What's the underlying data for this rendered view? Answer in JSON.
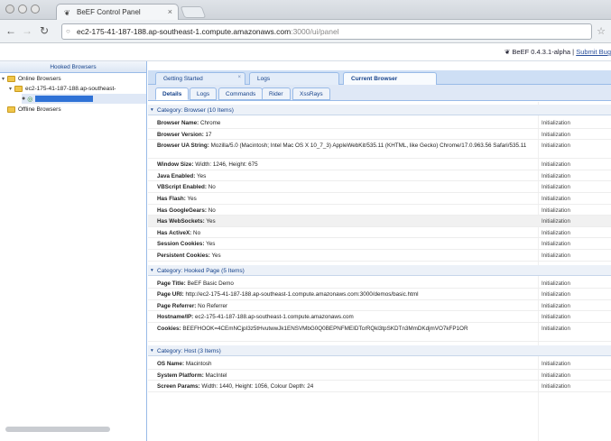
{
  "browser": {
    "tab_title": "BeEF Control Panel",
    "tab_favicon": "beef-logo-icon",
    "url_host": "ec2-175-41-187-188.ap-southeast-1.compute.amazonaws.com",
    "url_rest": ":3000/ui/panel"
  },
  "header": {
    "app_name": "BeEF",
    "version": "0.4.3.1-alpha",
    "submit_bug": "Submit Bug"
  },
  "sidebar": {
    "title": "Hooked Browsers",
    "online_label": "Online Browsers",
    "host_label": "ec2-175-41-187-188.ap-southeast-",
    "offline_label": "Offline Browsers"
  },
  "top_tabs": [
    {
      "label": "Getting Started"
    },
    {
      "label": "Logs"
    },
    {
      "label": "Current Browser"
    }
  ],
  "sub_tabs": [
    {
      "label": "Details"
    },
    {
      "label": "Logs"
    },
    {
      "label": "Commands"
    },
    {
      "label": "Rider"
    },
    {
      "label": "XssRays"
    }
  ],
  "details": {
    "categories": [
      {
        "header": "Category: Browser (10 Items)",
        "rows": [
          {
            "key": "Browser Name:",
            "value": "Chrome",
            "cmd": "Initialization"
          },
          {
            "key": "Browser Version:",
            "value": "17",
            "cmd": "Initialization"
          },
          {
            "key": "Browser UA String:",
            "value": "Mozilla/5.0 (Macintosh; Intel Mac OS X 10_7_3) AppleWebKit/535.11 (KHTML, like Gecko) Chrome/17.0.963.56 Safari/535.11",
            "cmd": "Initialization"
          },
          {
            "key": "Window Size:",
            "value": "Width: 1246, Height: 675",
            "cmd": "Initialization"
          },
          {
            "key": "Java Enabled:",
            "value": "Yes",
            "cmd": "Initialization"
          },
          {
            "key": "VBScript Enabled:",
            "value": "No",
            "cmd": "Initialization"
          },
          {
            "key": "Has Flash:",
            "value": "Yes",
            "cmd": "Initialization"
          },
          {
            "key": "Has GoogleGears:",
            "value": "No",
            "cmd": "Initialization"
          },
          {
            "key": "Has WebSockets:",
            "value": "Yes",
            "cmd": "Initialization"
          },
          {
            "key": "Has ActiveX:",
            "value": "No",
            "cmd": "Initialization"
          },
          {
            "key": "Session Cookies:",
            "value": "Yes",
            "cmd": "Initialization"
          },
          {
            "key": "Persistent Cookies:",
            "value": "Yes",
            "cmd": "Initialization"
          }
        ]
      },
      {
        "header": "Category: Hooked Page (5 Items)",
        "rows": [
          {
            "key": "Page Title:",
            "value": "BeEF Basic Demo",
            "cmd": "Initialization"
          },
          {
            "key": "Page URI:",
            "value": "http://ec2-175-41-187-188.ap-southeast-1.compute.amazonaws.com:3000/demos/basic.html",
            "cmd": "Initialization"
          },
          {
            "key": "Page Referrer:",
            "value": "No Referrer",
            "cmd": "Initialization"
          },
          {
            "key": "Hostname/IP:",
            "value": "ec2-175-41-187-188.ap-southeast-1.compute.amazonaws.com",
            "cmd": "Initialization"
          },
          {
            "key": "Cookies:",
            "value": "BEEFHOOK=4CEmNCjpI3z5tHvutwwJk1ENSVMbG0Q0BEPNFMEIDTcrRQkl3tpSKDTn3MmDKdjmVO7kFP1OR",
            "cmd": "Initialization"
          }
        ]
      },
      {
        "header": "Category: Host (3 Items)",
        "rows": [
          {
            "key": "OS Name:",
            "value": "Macintosh",
            "cmd": "Initialization"
          },
          {
            "key": "System Platform:",
            "value": "MacIntel",
            "cmd": "Initialization"
          },
          {
            "key": "Screen Params:",
            "value": "Width: 1440, Height: 1056, Colour Depth: 24",
            "cmd": "Initialization"
          }
        ]
      }
    ]
  }
}
